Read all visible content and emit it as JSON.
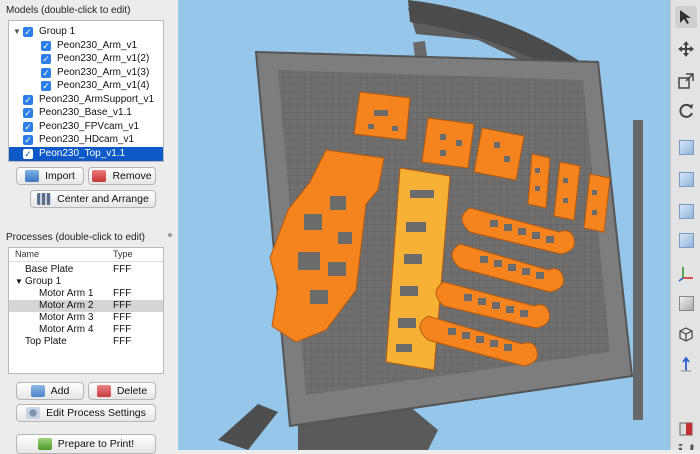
{
  "models_panel": {
    "title": "Models (double-click to edit)",
    "items": [
      {
        "label": "Group 1",
        "indent": 0,
        "disclosure": "▼",
        "checked": true
      },
      {
        "label": "Peon230_Arm_v1",
        "indent": 1,
        "checked": true
      },
      {
        "label": "Peon230_Arm_v1(2)",
        "indent": 1,
        "checked": true
      },
      {
        "label": "Peon230_Arm_v1(3)",
        "indent": 1,
        "checked": true
      },
      {
        "label": "Peon230_Arm_v1(4)",
        "indent": 1,
        "checked": true
      },
      {
        "label": "Peon230_ArmSupport_v1",
        "indent": 0,
        "checked": true
      },
      {
        "label": "Peon230_Base_v1.1",
        "indent": 0,
        "checked": true
      },
      {
        "label": "Peon230_FPVcam_v1",
        "indent": 0,
        "checked": true
      },
      {
        "label": "Peon230_HDcam_v1",
        "indent": 0,
        "checked": true
      },
      {
        "label": "Peon230_Top_v1.1",
        "indent": 0,
        "checked": true,
        "selected": true
      }
    ],
    "import_label": "Import",
    "remove_label": "Remove",
    "center_label": "Center and Arrange"
  },
  "processes_panel": {
    "title": "Processes (double-click to edit)",
    "col_name": "Name",
    "col_type": "Type",
    "rows": [
      {
        "name": "Base Plate",
        "type": "FFF",
        "indent": 1
      },
      {
        "name": "Group 1",
        "type": "",
        "indent": 0,
        "disclosure": "▼"
      },
      {
        "name": "Motor Arm 1",
        "type": "FFF",
        "indent": 2
      },
      {
        "name": "Motor Arm 2",
        "type": "FFF",
        "indent": 2,
        "highlighted": true
      },
      {
        "name": "Motor Arm 3",
        "type": "FFF",
        "indent": 2
      },
      {
        "name": "Motor Arm 4",
        "type": "FFF",
        "indent": 2
      },
      {
        "name": "Top Plate",
        "type": "FFF",
        "indent": 1
      }
    ],
    "add_label": "Add",
    "delete_label": "Delete",
    "edit_label": "Edit Process Settings",
    "prepare_label": "Prepare to Print!"
  },
  "viewport": {
    "sky_color": "#96c6ea",
    "bed_color": "#7a7a7a",
    "part_color": "#f5841f",
    "selected_part_color": "#f7b236"
  },
  "toolbar": {
    "tools": [
      "cursor-icon",
      "move-icon",
      "scale-icon",
      "rotate-icon",
      "view-iso-icon",
      "view-top-icon",
      "view-front-icon",
      "view-side-icon",
      "axes-icon",
      "solid-cube-icon",
      "wireframe-cube-icon",
      "axis-z-icon",
      "section-icon",
      "settings-gear-icon"
    ]
  }
}
